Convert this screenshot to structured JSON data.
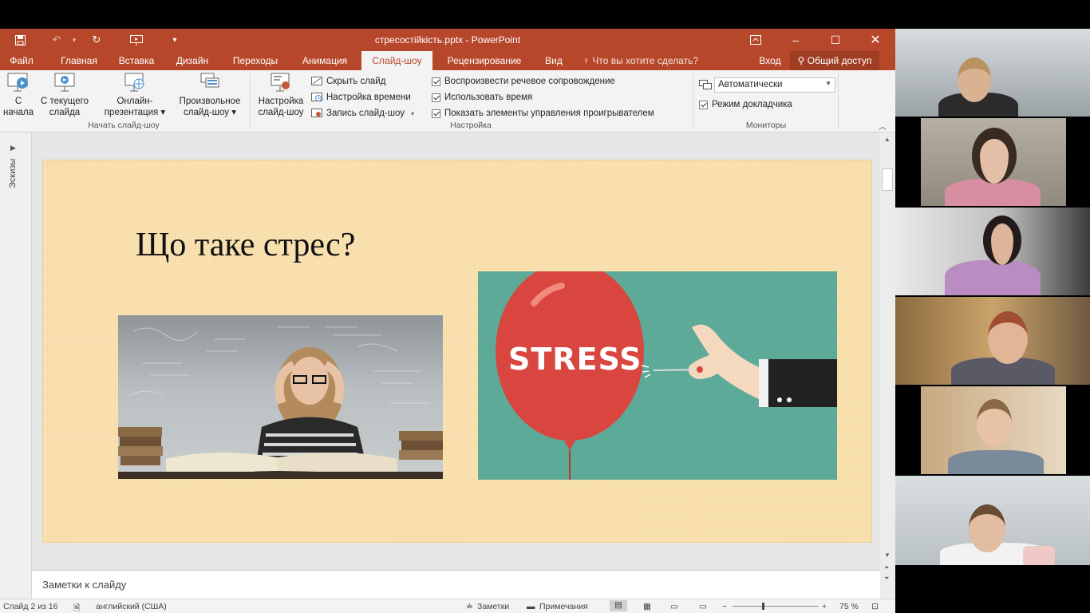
{
  "window": {
    "title": "стресостійкість.pptx - PowerPoint",
    "accent": "#b7472a"
  },
  "tabs": [
    "Файл",
    "Главная",
    "Вставка",
    "Дизайн",
    "Переходы",
    "Анимация",
    "Слайд-шоу",
    "Рецензирование",
    "Вид"
  ],
  "active_tab": "Слайд-шоу",
  "tell_me": "Что вы хотите сделать?",
  "sign_in": "Вход",
  "share": "Общий доступ",
  "ribbon": {
    "start_group": {
      "label": "Начать слайд-шоу",
      "from_beginning": [
        "С",
        "начала"
      ],
      "from_current": [
        "С текущего",
        "слайда"
      ],
      "online": [
        "Онлайн-",
        "презентация ▾"
      ],
      "custom": [
        "Произвольное",
        "слайд-шоу ▾"
      ]
    },
    "setup_group": {
      "label": "Настройка",
      "setup_button": [
        "Настройка",
        "слайд-шоу"
      ],
      "hide_slide": "Скрыть слайд",
      "rehearse": "Настройка времени",
      "record": "Запись слайд-шоу",
      "play_narrations": "Воспроизвести речевое сопровождение",
      "use_timings": "Использовать время",
      "show_media_controls": "Показать элементы управления проигрывателем"
    },
    "monitors_group": {
      "label": "Мониторы",
      "monitor_value": "Автоматически",
      "presenter_view": "Режим докладчика"
    }
  },
  "thumbnails_label": "Эскизы",
  "slide": {
    "title": "Що таке стрес?",
    "balloon_text": "STRESS"
  },
  "notes_placeholder": "Заметки к слайду",
  "status": {
    "slide_counter": "Слайд 2 из 16",
    "language": "английский (США)",
    "notes": "Заметки",
    "comments": "Примечания",
    "zoom": "75 %"
  }
}
